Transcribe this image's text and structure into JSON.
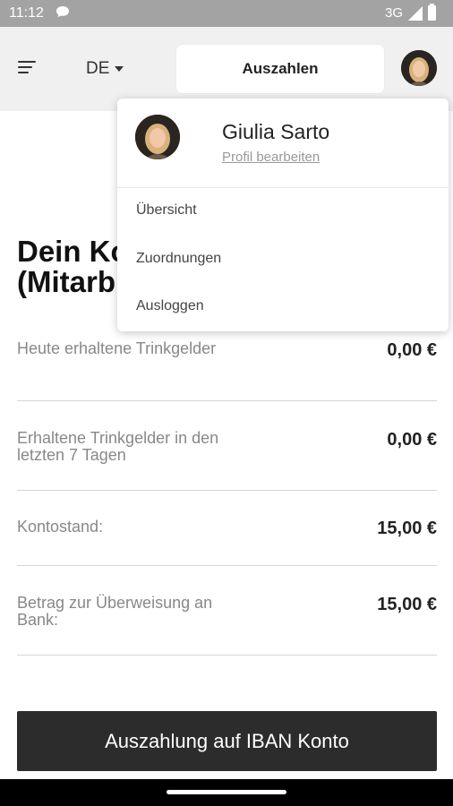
{
  "status_bar": {
    "time": "11:12",
    "network": "3G"
  },
  "header": {
    "language": "DE",
    "payout_button": "Auszahlen"
  },
  "main": {
    "title_line1": "Dein Ko",
    "title_line2": "(Mitarb",
    "rows": [
      {
        "label": "Heute erhaltene Trinkgelder",
        "value": "0,00 €"
      },
      {
        "label": "Erhaltene Trinkgelder in den letzten 7 Tagen",
        "value": "0,00 €"
      },
      {
        "label": "Kontostand:",
        "value": "15,00 €"
      },
      {
        "label": "Betrag zur Überweisung an Bank:",
        "value": "15,00 €"
      }
    ],
    "bottom_button": "Auszahlung auf IBAN Konto"
  },
  "dropdown": {
    "user_name": "Giulia Sarto",
    "edit_profile": "Profil bearbeiten",
    "items": [
      "Übersicht",
      "Zuordnungen",
      "Ausloggen"
    ]
  },
  "colors": {
    "status_bar": "#a3a3a3",
    "app_bar": "#f0f0f0",
    "primary_button": "#2c2c2c"
  },
  "icons": [
    "chat-bubble-icon",
    "signal-icon",
    "battery-icon",
    "menu-icon",
    "caret-down-icon"
  ]
}
